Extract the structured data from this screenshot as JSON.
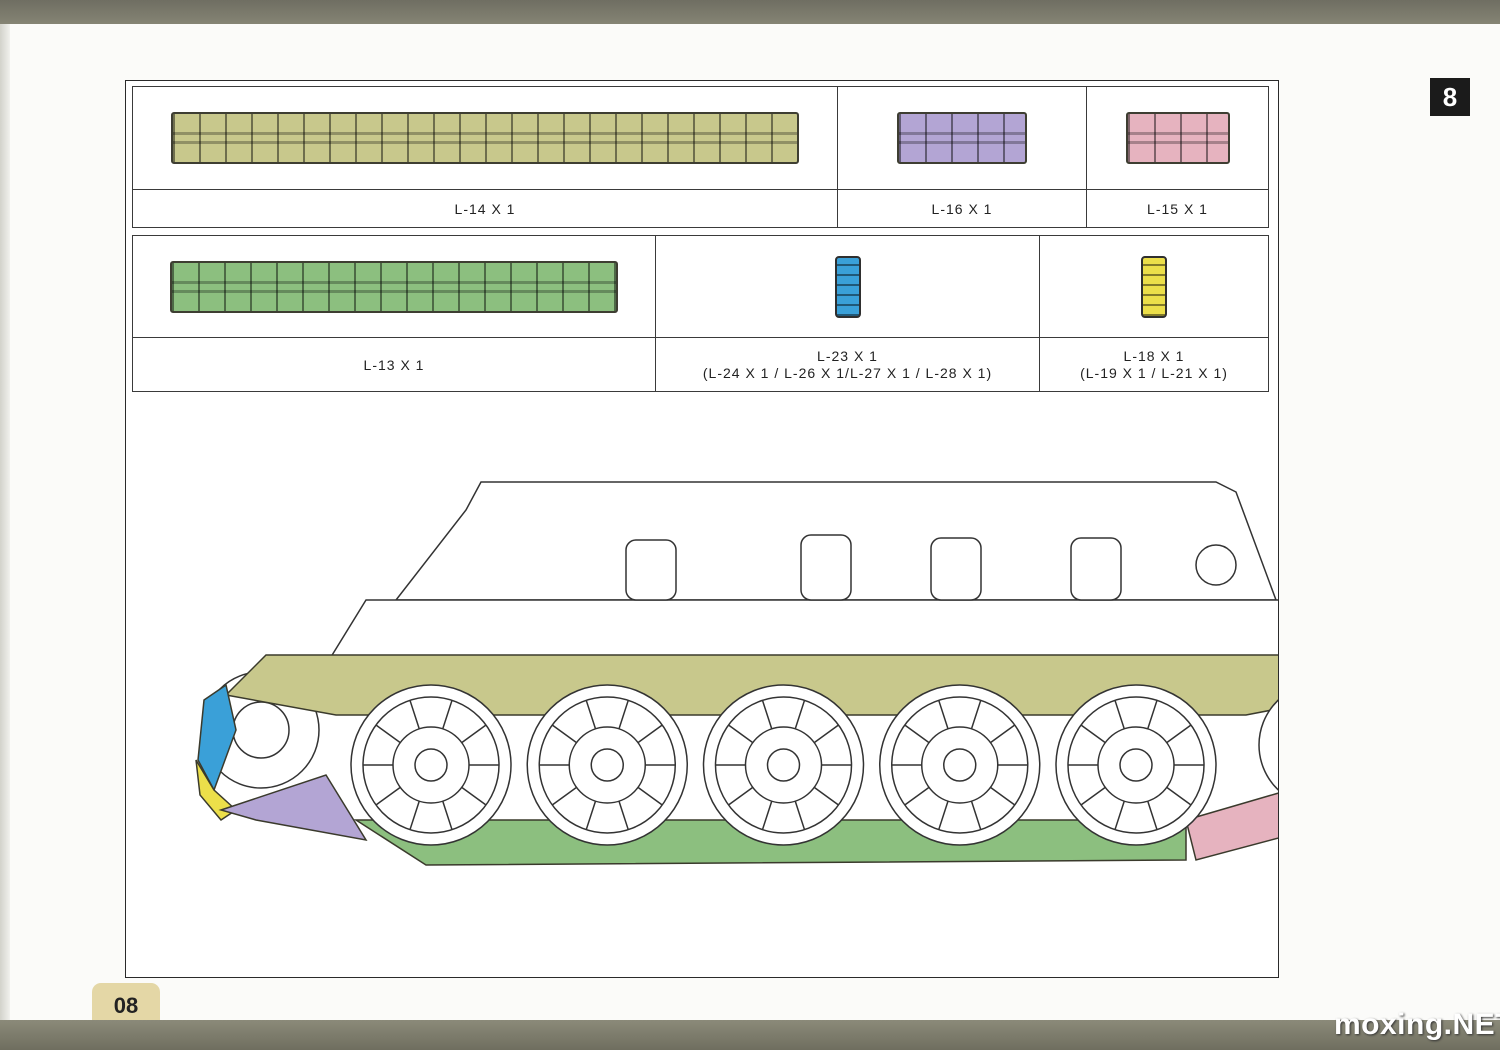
{
  "page": {
    "number": "08",
    "step": "8",
    "watermark": "moxing.NET"
  },
  "colors": {
    "olive": "#c8c88c",
    "purple": "#b3a5d4",
    "pink": "#e6b3bf",
    "green": "#8cbf7f",
    "blue": "#3aa0d8",
    "yellow": "#ecdf4a"
  },
  "parts_row1": [
    {
      "label": "L-14 X 1",
      "color": "#c8c88c",
      "count": 24
    },
    {
      "label": "L-16 X 1",
      "color": "#b3a5d4",
      "count": 5
    },
    {
      "label": "L-15 X 1",
      "color": "#e6b3bf",
      "count": 4
    }
  ],
  "parts_row2": [
    {
      "label": "L-13 X 1",
      "color": "#8cbf7f",
      "count": 17
    },
    {
      "label": "L-23 X 1",
      "sublabel": "(L-24 X 1 / L-26 X 1/L-27 X 1 / L-28 X 1)",
      "color": "#3aa0d8",
      "count": 1
    },
    {
      "label": "L-18 X 1",
      "sublabel": "(L-19 X 1 / L-21 X 1)",
      "color": "#ecdf4a",
      "count": 1
    }
  ],
  "illustration": {
    "road_wheels": 5
  }
}
